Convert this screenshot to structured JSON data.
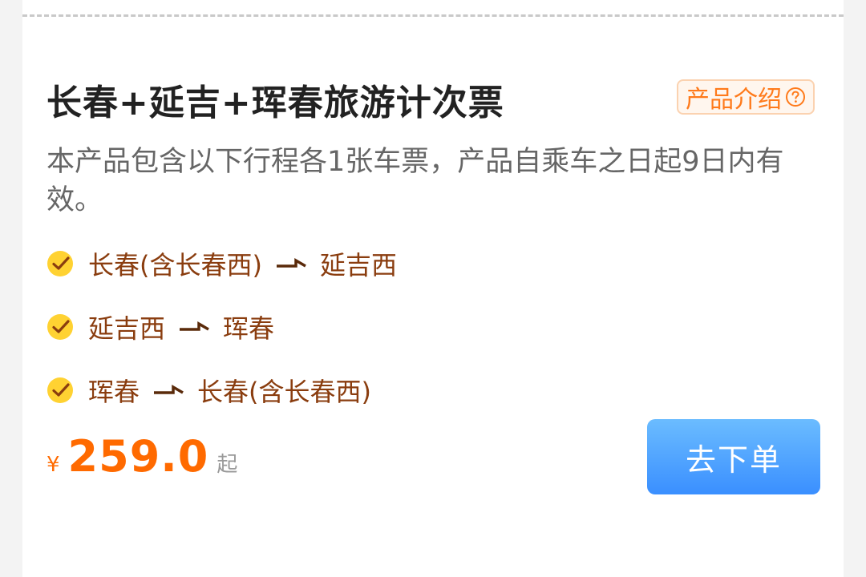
{
  "product": {
    "title": "长春+延吉+珲春旅游计次票",
    "intro_label": "产品介绍",
    "description": "本产品包含以下行程各1张车票，产品自乘车之日起9日内有效。"
  },
  "routes": [
    {
      "from": "长春(含长春西)",
      "to": "延吉西"
    },
    {
      "from": "延吉西",
      "to": "珲春"
    },
    {
      "from": "珲春",
      "to": "长春(含长春西)"
    }
  ],
  "price": {
    "currency": "¥",
    "amount": "259.0",
    "suffix": "起"
  },
  "order_button": {
    "label": "去下单"
  },
  "icons": {
    "check": "check-circle-icon",
    "arrow": "arrow-right-icon",
    "help": "question-circle-icon"
  },
  "colors": {
    "price": "#ff6a00",
    "station": "#8a3d0f",
    "check_fill": "#ffd232",
    "button": "#3a8fff"
  }
}
